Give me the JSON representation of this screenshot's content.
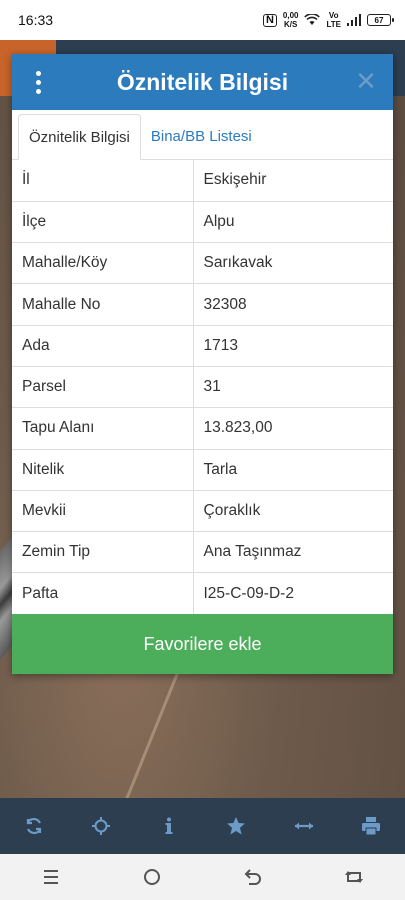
{
  "status_bar": {
    "time": "16:33",
    "net_speed_value": "0,00",
    "net_speed_unit": "K/S",
    "volte_top": "Vo",
    "volte_bottom": "LTE",
    "battery": "67"
  },
  "dialog": {
    "title": "Öznitelik Bilgisi",
    "close_symbol": "✕",
    "tabs": [
      {
        "label": "Öznitelik Bilgisi",
        "active": true
      },
      {
        "label": "Bina/BB Listesi",
        "active": false
      }
    ],
    "rows": [
      {
        "key": "İl",
        "value": "Eskişehir"
      },
      {
        "key": "İlçe",
        "value": "Alpu"
      },
      {
        "key": "Mahalle/Köy",
        "value": "Sarıkavak"
      },
      {
        "key": "Mahalle No",
        "value": "32308"
      },
      {
        "key": "Ada",
        "value": "1713"
      },
      {
        "key": "Parsel",
        "value": "31"
      },
      {
        "key": "Tapu Alanı",
        "value": "13.823,00"
      },
      {
        "key": "Nitelik",
        "value": "Tarla"
      },
      {
        "key": "Mevkii",
        "value": "Çoraklık"
      },
      {
        "key": "Zemin Tip",
        "value": "Ana Taşınmaz"
      },
      {
        "key": "Pafta",
        "value": "I25-C-09-D-2"
      }
    ],
    "favorite_button": "Favorilere ekle"
  },
  "toolbar": {
    "icons": [
      "refresh-icon",
      "locate-icon",
      "info-icon",
      "star-icon",
      "measure-icon",
      "print-icon"
    ]
  },
  "navbar": {
    "icons": [
      "menu-icon",
      "home-icon",
      "back-icon",
      "recent-icon"
    ]
  },
  "colors": {
    "header": "#2b7bbd",
    "favorite": "#4cae5b",
    "toolbar": "#2c3e50",
    "toolbar_icon": "#6d9bc8"
  }
}
